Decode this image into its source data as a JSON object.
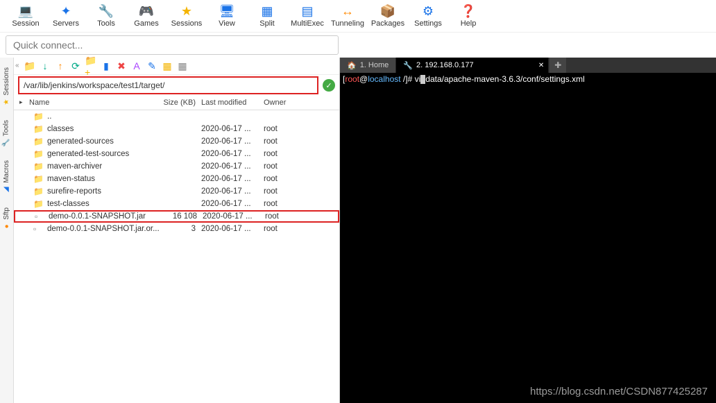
{
  "toolbar": [
    {
      "label": "Session",
      "icon": "💻",
      "color": "ic-blue"
    },
    {
      "label": "Servers",
      "icon": "✦",
      "color": "ic-blue"
    },
    {
      "label": "Tools",
      "icon": "🔧",
      "color": "ic-red"
    },
    {
      "label": "Games",
      "icon": "🎮",
      "color": "ic-gray"
    },
    {
      "label": "Sessions",
      "icon": "★",
      "color": "ic-yellow"
    },
    {
      "label": "View",
      "icon": "🖥",
      "color": "ic-blue"
    },
    {
      "label": "Split",
      "icon": "▦",
      "color": "ic-blue"
    },
    {
      "label": "MultiExec",
      "icon": "▤",
      "color": "ic-blue"
    },
    {
      "label": "Tunneling",
      "icon": "↔",
      "color": "ic-orange"
    },
    {
      "label": "Packages",
      "icon": "📦",
      "color": "ic-blue"
    },
    {
      "label": "Settings",
      "icon": "⚙",
      "color": "ic-blue"
    },
    {
      "label": "Help",
      "icon": "❓",
      "color": "ic-blue"
    }
  ],
  "quick_connect_placeholder": "Quick connect...",
  "sidebar_tabs": [
    {
      "label": "Sessions",
      "icon": "★",
      "color": "ic-yellow"
    },
    {
      "label": "Tools",
      "icon": "🔧",
      "color": "ic-pink"
    },
    {
      "label": "Macros",
      "icon": "◢",
      "color": "ic-blue"
    },
    {
      "label": "Sftp",
      "icon": "●",
      "color": "ic-orange"
    }
  ],
  "file_toolbar_icons": [
    {
      "glyph": "📁",
      "color": "ic-yellow",
      "name": "folder"
    },
    {
      "glyph": "↓",
      "color": "ic-green",
      "name": "download"
    },
    {
      "glyph": "↑",
      "color": "ic-orange",
      "name": "upload"
    },
    {
      "glyph": "⟳",
      "color": "ic-green",
      "name": "refresh"
    },
    {
      "glyph": "📁+",
      "color": "ic-yellow",
      "name": "new-folder"
    },
    {
      "glyph": "▮",
      "color": "ic-blue",
      "name": "item"
    },
    {
      "glyph": "✖",
      "color": "ic-red",
      "name": "delete"
    },
    {
      "glyph": "A",
      "color": "ic-purple",
      "name": "text"
    },
    {
      "glyph": "✎",
      "color": "ic-blue",
      "name": "edit"
    },
    {
      "glyph": "▦",
      "color": "ic-yellow",
      "name": "grid"
    },
    {
      "glyph": "▦",
      "color": "ic-gray",
      "name": "list"
    }
  ],
  "current_path": "/var/lib/jenkins/workspace/test1/target/",
  "columns": {
    "name": "Name",
    "size": "Size (KB)",
    "modified": "Last modified",
    "owner": "Owner"
  },
  "files": [
    {
      "type": "up",
      "name": "..",
      "size": "",
      "modified": "",
      "owner": ""
    },
    {
      "type": "folder",
      "name": "classes",
      "size": "",
      "modified": "2020-06-17 ...",
      "owner": "root"
    },
    {
      "type": "folder",
      "name": "generated-sources",
      "size": "",
      "modified": "2020-06-17 ...",
      "owner": "root"
    },
    {
      "type": "folder",
      "name": "generated-test-sources",
      "size": "",
      "modified": "2020-06-17 ...",
      "owner": "root"
    },
    {
      "type": "folder",
      "name": "maven-archiver",
      "size": "",
      "modified": "2020-06-17 ...",
      "owner": "root"
    },
    {
      "type": "folder",
      "name": "maven-status",
      "size": "",
      "modified": "2020-06-17 ...",
      "owner": "root"
    },
    {
      "type": "folder",
      "name": "surefire-reports",
      "size": "",
      "modified": "2020-06-17 ...",
      "owner": "root"
    },
    {
      "type": "folder",
      "name": "test-classes",
      "size": "",
      "modified": "2020-06-17 ...",
      "owner": "root"
    },
    {
      "type": "file",
      "name": "demo-0.0.1-SNAPSHOT.jar",
      "size": "16 108",
      "modified": "2020-06-17 ...",
      "owner": "root",
      "highlighted": true
    },
    {
      "type": "file",
      "name": "demo-0.0.1-SNAPSHOT.jar.or...",
      "size": "3",
      "modified": "2020-06-17 ...",
      "owner": "root"
    }
  ],
  "terminal_tabs": [
    {
      "label": "1. Home",
      "icon": "🏠",
      "active": false
    },
    {
      "label": "2. 192.168.0.177",
      "icon": "🔧",
      "active": true
    }
  ],
  "terminal_add": "✚",
  "terminal_line": {
    "bracket_open": "[",
    "user": "root",
    "at": "@",
    "host": "localhost",
    "path": " /",
    "bracket_close": "]# ",
    "cmd_pre": "vi",
    "cmd_post": "data/apache-maven-3.6.3/conf/settings.xml"
  },
  "watermark": "https://blog.csdn.net/CSDN877425287"
}
